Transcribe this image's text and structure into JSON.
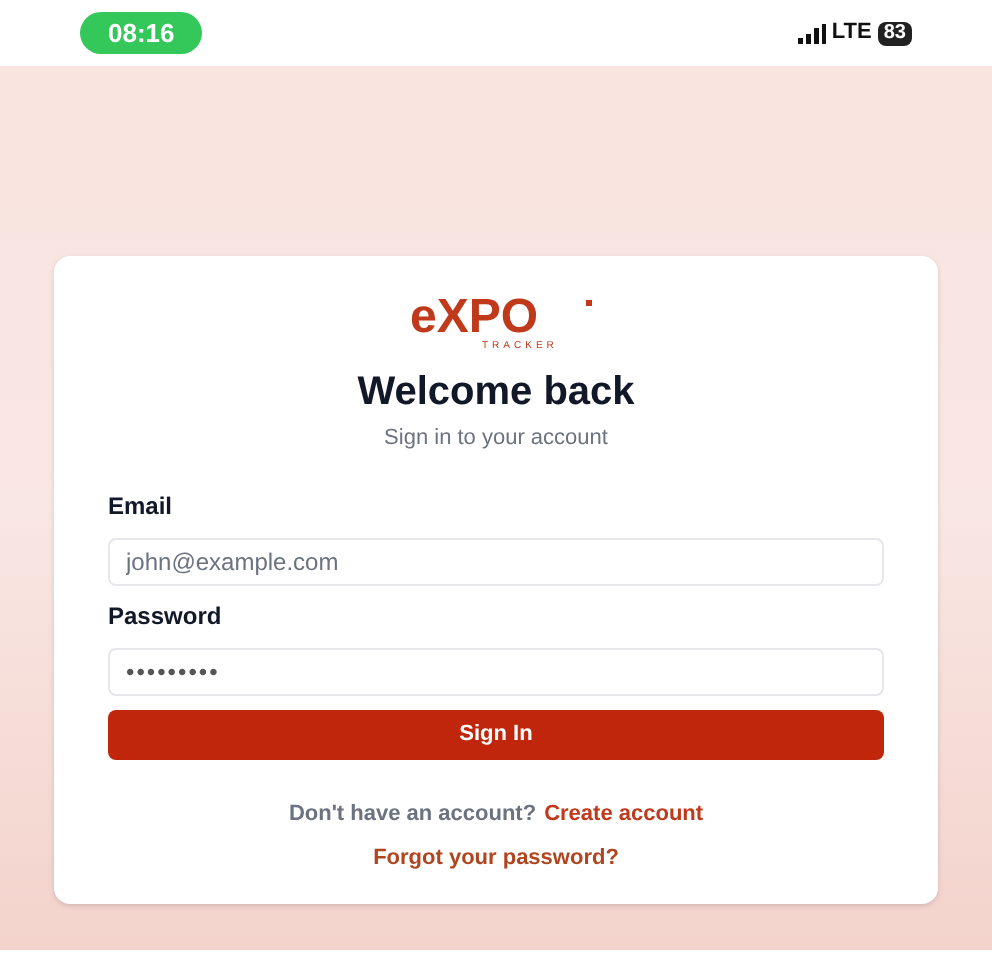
{
  "status_bar": {
    "time": "08:16",
    "network": "LTE",
    "battery": "83"
  },
  "logo": {
    "wordmark": "eXPO",
    "tagline": "TRACKER"
  },
  "title": "Welcome back",
  "subtitle": "Sign in to your account",
  "fields": [
    {
      "label": "Email",
      "value": "john@example.com",
      "kind": "text"
    },
    {
      "label": "Password",
      "value": "•••••••••",
      "kind": "password"
    }
  ],
  "submit": "Sign In",
  "signup": {
    "prompt": "Don't have an account?",
    "link": "Create account"
  },
  "forgot": "Forgot your password?"
}
